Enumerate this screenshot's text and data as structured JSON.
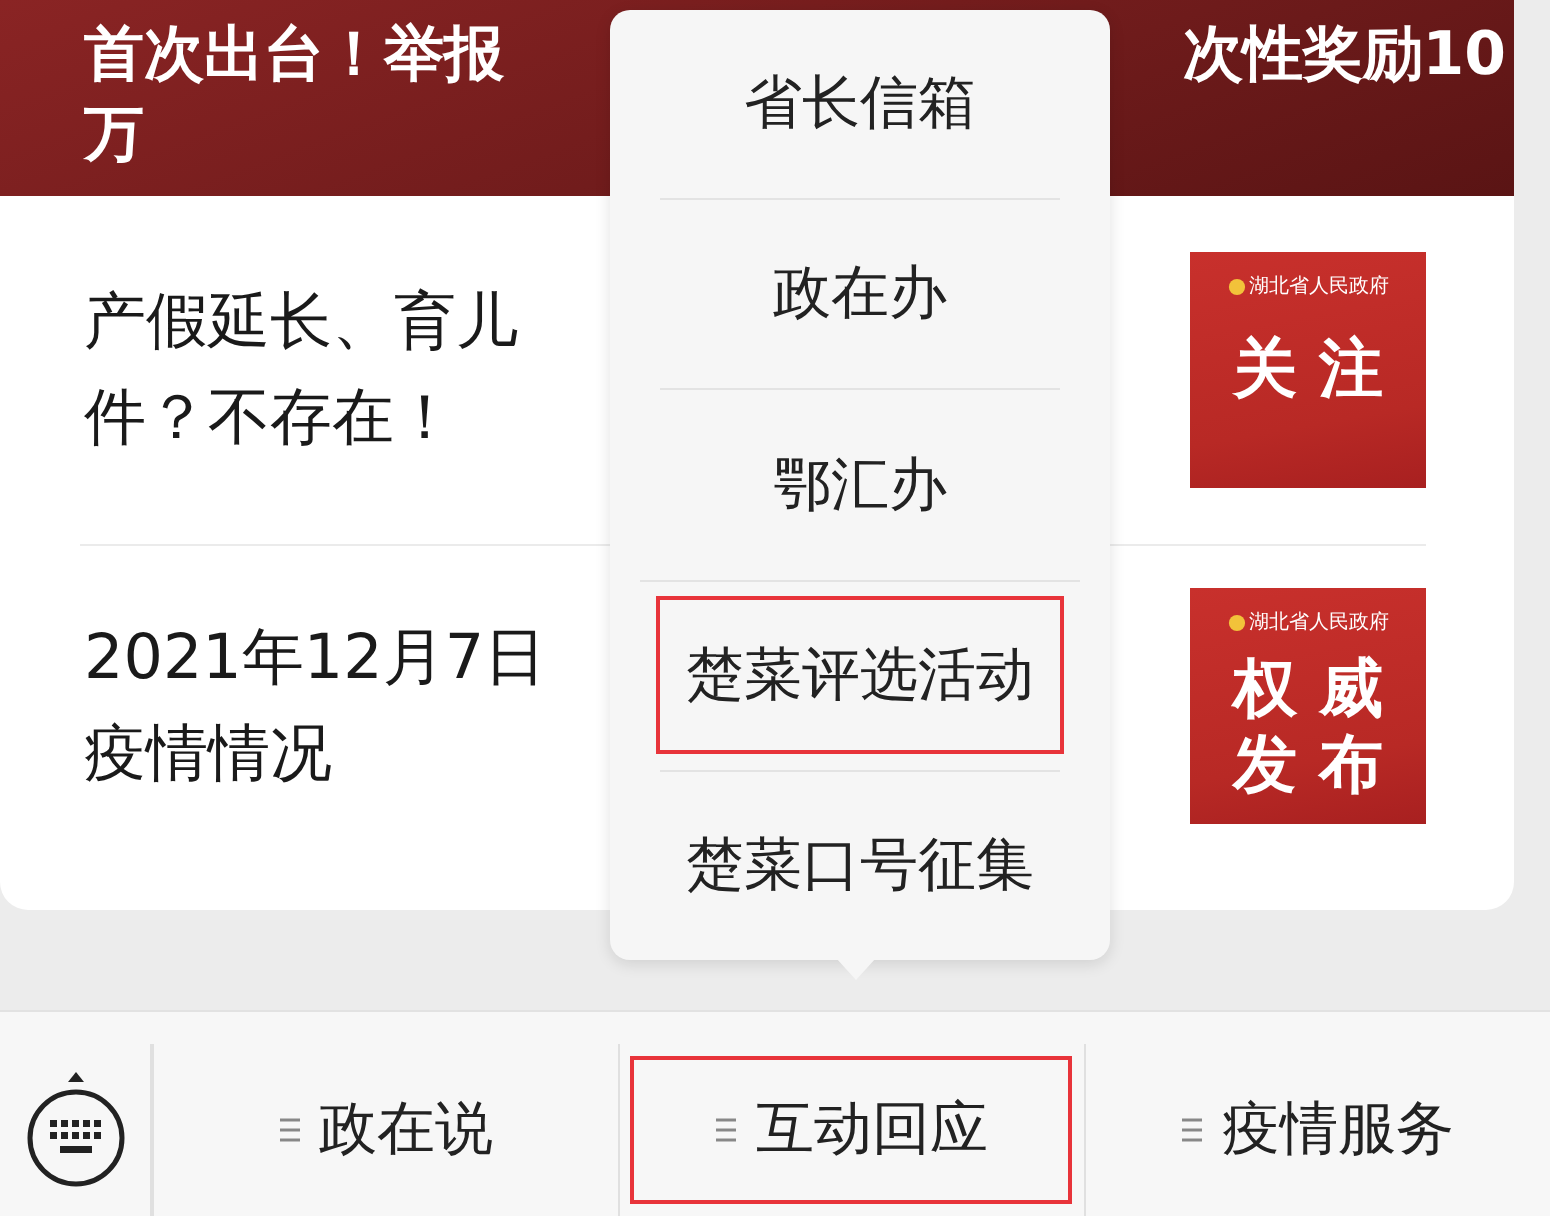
{
  "banner": {
    "headline_left": "首次出台！举报",
    "headline_right": "次性奖励10",
    "headline_line2": "万"
  },
  "articles": [
    {
      "lines": [
        "产假延长、育儿",
        "件？不存在！"
      ],
      "thumbnail": {
        "org": "湖北省人民政府",
        "title_lines": [
          "关 注"
        ]
      }
    },
    {
      "lines": [
        "2021年12月7日",
        "疫情情况"
      ],
      "thumbnail": {
        "org": "湖北省人民政府",
        "title_lines": [
          "权 威",
          "发 布"
        ]
      }
    }
  ],
  "popup_menu": {
    "items": [
      {
        "label": "省长信箱",
        "highlighted": false
      },
      {
        "label": "政在办",
        "highlighted": false
      },
      {
        "label": "鄂汇办",
        "highlighted": false
      },
      {
        "label": "楚菜评选活动",
        "highlighted": true
      },
      {
        "label": "楚菜口号征集",
        "highlighted": false
      }
    ]
  },
  "bottom_menu": {
    "tabs": [
      {
        "label": "政在说",
        "highlighted": false
      },
      {
        "label": "互动回应",
        "highlighted": true
      },
      {
        "label": "疫情服务",
        "highlighted": false
      }
    ]
  }
}
